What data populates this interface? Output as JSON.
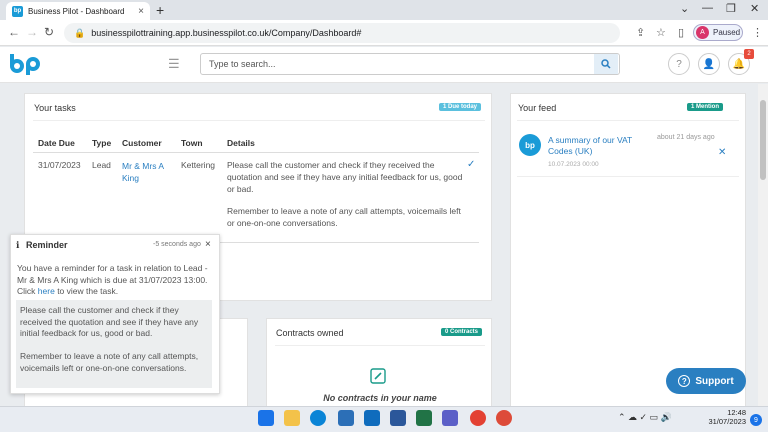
{
  "browser": {
    "tab_title": "Business Pilot - Dashboard",
    "url": "businesspilottraining.app.businesspilot.co.uk/Company/Dashboard#",
    "profile_initial": "A",
    "profile_label": "Paused"
  },
  "header": {
    "search_placeholder": "Type to search...",
    "notif_count": "2"
  },
  "tasks": {
    "title": "Your tasks",
    "badge": "1 Due today",
    "columns": [
      "Date Due",
      "Type",
      "Customer",
      "Town",
      "Details"
    ],
    "rows": [
      {
        "date": "31/07/2023",
        "type": "Lead",
        "customer_l1": "Mr & Mrs A",
        "customer_l2": "King",
        "town": "Kettering",
        "details_1": "Please call the customer and check if they received the quotation and see if they have any initial feedback for us, good or bad.",
        "details_2": "Remember to leave a note of any call attempts, voicemails left or one-on-one conversations."
      }
    ]
  },
  "feed": {
    "title": "Your feed",
    "badge": "1 Mention",
    "item_title": "A summary of our VAT Codes (UK)",
    "item_time": "about 21 days ago",
    "item_date": "10.07.2023 00:00"
  },
  "contracts": {
    "title": "Contracts owned",
    "badge": "0 Contracts",
    "empty": "No contracts in your name"
  },
  "reminder": {
    "title": "Reminder",
    "time": "-5 seconds ago",
    "body": "You have a reminder for a task in relation to Lead - Mr & Mrs A King which is due at 31/07/2023 13:00. Click",
    "link": "here",
    "body_end": "to view the task.",
    "detail_1": "Please call the customer and check if they received the quotation and see if they have any initial feedback for us, good or bad.",
    "detail_2": "Remember to leave a note of any call attempts, voicemails left or one-on-one conversations."
  },
  "support": "Support",
  "taskbar": {
    "time": "12:48",
    "date": "31/07/2023",
    "notif": "9"
  },
  "colors": {
    "brand": "#2a7fc1",
    "badge_blue": "#5bc0de",
    "badge_teal": "#1a9b8a"
  }
}
